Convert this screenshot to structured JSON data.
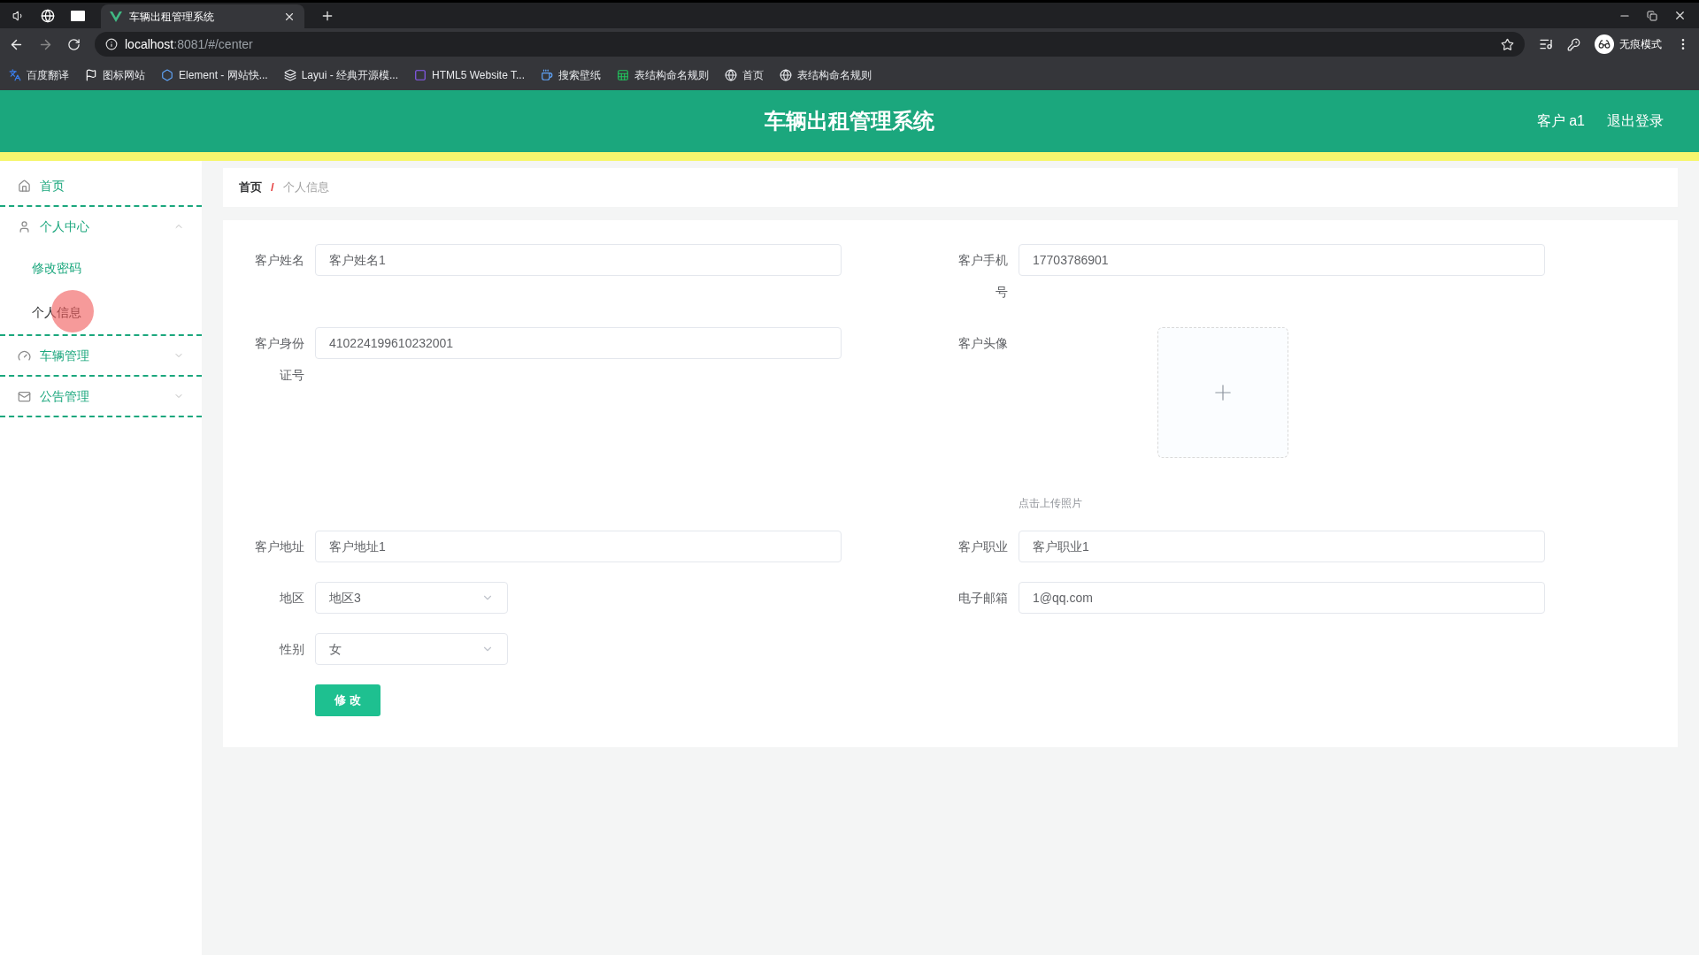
{
  "browser": {
    "tabs": [
      {
        "title": "车辆出租管理系统",
        "selected": true
      }
    ],
    "address": {
      "host": "localhost",
      "path": ":8081/#/center"
    },
    "bookmarks": [
      {
        "label": "百度翻译"
      },
      {
        "label": "图标网站"
      },
      {
        "label": "Element - 网站快..."
      },
      {
        "label": "Layui - 经典开源模..."
      },
      {
        "label": "HTML5 Website T..."
      },
      {
        "label": "搜索壁纸"
      },
      {
        "label": "表结构命名规则"
      },
      {
        "label": "首页"
      },
      {
        "label": "表结构命名规则"
      }
    ],
    "profile": "无痕模式"
  },
  "header": {
    "title": "车辆出租管理系统",
    "user": "客户 a1",
    "logout": "退出登录"
  },
  "sidebar": {
    "items": [
      {
        "label": "首页"
      },
      {
        "label": "个人中心",
        "expanded": true,
        "children": [
          {
            "label": "修改密码",
            "selected": false
          },
          {
            "label": "个人信息",
            "selected": true
          }
        ]
      },
      {
        "label": "车辆管理",
        "expanded": false
      },
      {
        "label": "公告管理",
        "expanded": false
      }
    ]
  },
  "breadcrumb": {
    "items": [
      "首页",
      "个人信息"
    ],
    "separator": "/"
  },
  "form": {
    "rows": [
      [
        {
          "kind": "text",
          "label": "客户姓名",
          "value": "客户姓名1"
        },
        {
          "kind": "text",
          "label": "客户手机号",
          "value": "17703786901"
        }
      ],
      [
        {
          "kind": "text",
          "label": "客户身份证号",
          "value": "410224199610232001"
        },
        {
          "kind": "upload",
          "label": "客户头像",
          "hint": "点击上传照片"
        }
      ],
      [
        {
          "kind": "text",
          "label": "客户地址",
          "value": "客户地址1"
        },
        {
          "kind": "text",
          "label": "客户职业",
          "value": "客户职业1"
        }
      ],
      [
        {
          "kind": "select",
          "label": "地区",
          "value": "地区3"
        },
        {
          "kind": "text",
          "label": "电子邮箱",
          "value": "1@qq.com"
        }
      ],
      [
        {
          "kind": "select",
          "label": "性别",
          "value": "女"
        }
      ]
    ],
    "submit": "修 改"
  }
}
